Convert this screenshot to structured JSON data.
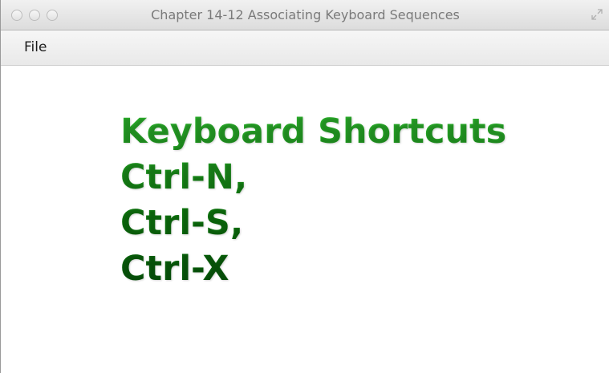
{
  "window": {
    "title": "Chapter 14-12 Associating Keyboard Sequences"
  },
  "menubar": {
    "items": [
      {
        "label": "File"
      }
    ]
  },
  "content": {
    "lines": [
      "Keyboard Shortcuts",
      "Ctrl-N,",
      "Ctrl-S,",
      "Ctrl-X"
    ],
    "text_color": "#0f7a0f"
  },
  "icons": {
    "traffic_lights": [
      "close-icon",
      "minimize-icon",
      "zoom-icon"
    ],
    "fullscreen": "fullscreen-icon"
  }
}
